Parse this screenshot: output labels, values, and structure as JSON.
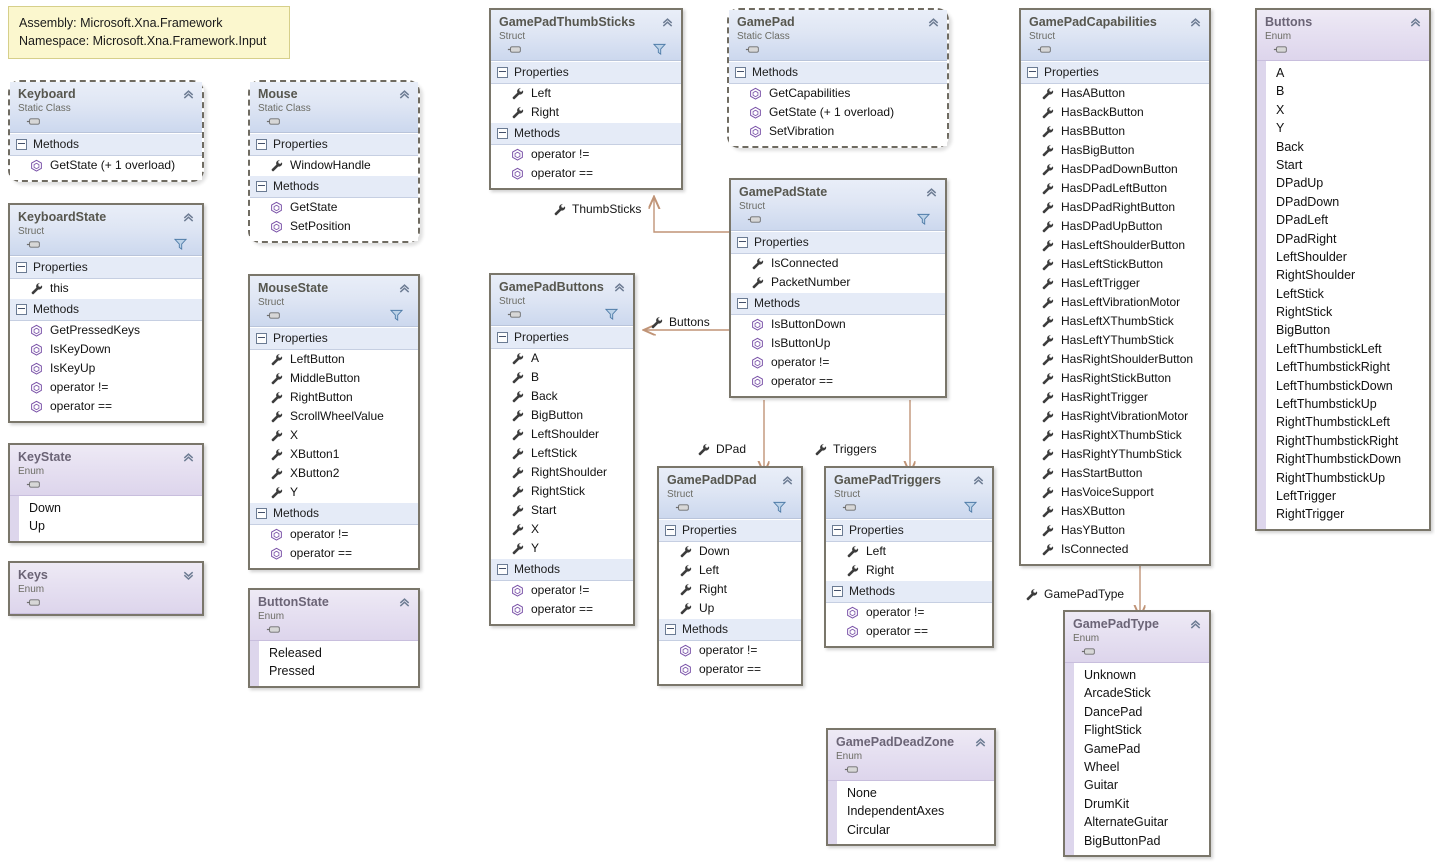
{
  "note": {
    "line1": "Assembly: Microsoft.Xna.Framework",
    "line2": "Namespace: Microsoft.Xna.Framework.Input"
  },
  "nodes": {
    "keyboard": {
      "title": "Keyboard",
      "kind": "Static Class",
      "groups": [
        {
          "label": "Methods",
          "members": [
            "GetState (+ 1 overload)"
          ]
        }
      ]
    },
    "keyboardState": {
      "title": "KeyboardState",
      "kind": "Struct",
      "groups": [
        {
          "label": "Properties",
          "members": [
            "this"
          ]
        },
        {
          "label": "Methods",
          "members": [
            "GetPressedKeys",
            "IsKeyDown",
            "IsKeyUp",
            "operator !=",
            "operator =="
          ]
        }
      ]
    },
    "keyState": {
      "title": "KeyState",
      "kind": "Enum",
      "values": [
        "Down",
        "Up"
      ]
    },
    "keys": {
      "title": "Keys",
      "kind": "Enum",
      "values": []
    },
    "mouse": {
      "title": "Mouse",
      "kind": "Static Class",
      "groups": [
        {
          "label": "Properties",
          "members": [
            "WindowHandle"
          ]
        },
        {
          "label": "Methods",
          "members": [
            "GetState",
            "SetPosition"
          ]
        }
      ]
    },
    "mouseState": {
      "title": "MouseState",
      "kind": "Struct",
      "groups": [
        {
          "label": "Properties",
          "members": [
            "LeftButton",
            "MiddleButton",
            "RightButton",
            "ScrollWheelValue",
            "X",
            "XButton1",
            "XButton2",
            "Y"
          ]
        },
        {
          "label": "Methods",
          "members": [
            "operator !=",
            "operator =="
          ]
        }
      ]
    },
    "buttonState": {
      "title": "ButtonState",
      "kind": "Enum",
      "values": [
        "Released",
        "Pressed"
      ]
    },
    "gamePadThumbSticks": {
      "title": "GamePadThumbSticks",
      "kind": "Struct",
      "groups": [
        {
          "label": "Properties",
          "members": [
            "Left",
            "Right"
          ]
        },
        {
          "label": "Methods",
          "members": [
            "operator !=",
            "operator =="
          ]
        }
      ]
    },
    "gamePad": {
      "title": "GamePad",
      "kind": "Static Class",
      "groups": [
        {
          "label": "Methods",
          "members": [
            "GetCapabilities",
            "GetState (+ 1 overload)",
            "SetVibration"
          ]
        }
      ]
    },
    "gamePadState": {
      "title": "GamePadState",
      "kind": "Struct",
      "groups": [
        {
          "label": "Properties",
          "members": [
            "IsConnected",
            "PacketNumber"
          ]
        },
        {
          "label": "Methods",
          "members": [
            "IsButtonDown",
            "IsButtonUp",
            "operator !=",
            "operator =="
          ]
        }
      ]
    },
    "gamePadButtons": {
      "title": "GamePadButtons",
      "kind": "Struct",
      "groups": [
        {
          "label": "Properties",
          "members": [
            "A",
            "B",
            "Back",
            "BigButton",
            "LeftShoulder",
            "LeftStick",
            "RightShoulder",
            "RightStick",
            "Start",
            "X",
            "Y"
          ]
        },
        {
          "label": "Methods",
          "members": [
            "operator !=",
            "operator =="
          ]
        }
      ]
    },
    "gamePadDPad": {
      "title": "GamePadDPad",
      "kind": "Struct",
      "groups": [
        {
          "label": "Properties",
          "members": [
            "Down",
            "Left",
            "Right",
            "Up"
          ]
        },
        {
          "label": "Methods",
          "members": [
            "operator !=",
            "operator =="
          ]
        }
      ]
    },
    "gamePadTriggers": {
      "title": "GamePadTriggers",
      "kind": "Struct",
      "groups": [
        {
          "label": "Properties",
          "members": [
            "Left",
            "Right"
          ]
        },
        {
          "label": "Methods",
          "members": [
            "operator !=",
            "operator =="
          ]
        }
      ]
    },
    "gamePadCapabilities": {
      "title": "GamePadCapabilities",
      "kind": "Struct",
      "groups": [
        {
          "label": "Properties",
          "members": [
            "HasAButton",
            "HasBackButton",
            "HasBButton",
            "HasBigButton",
            "HasDPadDownButton",
            "HasDPadLeftButton",
            "HasDPadRightButton",
            "HasDPadUpButton",
            "HasLeftShoulderButton",
            "HasLeftStickButton",
            "HasLeftTrigger",
            "HasLeftVibrationMotor",
            "HasLeftXThumbStick",
            "HasLeftYThumbStick",
            "HasRightShoulderButton",
            "HasRightStickButton",
            "HasRightTrigger",
            "HasRightVibrationMotor",
            "HasRightXThumbStick",
            "HasRightYThumbStick",
            "HasStartButton",
            "HasVoiceSupport",
            "HasXButton",
            "HasYButton",
            "IsConnected"
          ]
        }
      ]
    },
    "buttons": {
      "title": "Buttons",
      "kind": "Enum",
      "values": [
        "A",
        "B",
        "X",
        "Y",
        "Back",
        "Start",
        "DPadUp",
        "DPadDown",
        "DPadLeft",
        "DPadRight",
        "LeftShoulder",
        "RightShoulder",
        "LeftStick",
        "RightStick",
        "BigButton",
        "LeftThumbstickLeft",
        "LeftThumbstickRight",
        "LeftThumbstickDown",
        "LeftThumbstickUp",
        "RightThumbstickLeft",
        "RightThumbstickRight",
        "RightThumbstickDown",
        "RightThumbstickUp",
        "LeftTrigger",
        "RightTrigger"
      ]
    },
    "gamePadType": {
      "title": "GamePadType",
      "kind": "Enum",
      "values": [
        "Unknown",
        "ArcadeStick",
        "DancePad",
        "FlightStick",
        "GamePad",
        "Wheel",
        "Guitar",
        "DrumKit",
        "AlternateGuitar",
        "BigButtonPad"
      ]
    },
    "gamePadDeadZone": {
      "title": "GamePadDeadZone",
      "kind": "Enum",
      "values": [
        "None",
        "IndependentAxes",
        "Circular"
      ]
    }
  },
  "associations": {
    "thumbSticks": "ThumbSticks",
    "buttons": "Buttons",
    "dpad": "DPad",
    "triggers": "Triggers",
    "gamePadType": "GamePadType"
  },
  "colors": {
    "note_bg": "#fbf7ce",
    "class_header": "#dfe6f4",
    "enum_header": "#e6e0f1",
    "group_row": "#e5ebf7",
    "connector": "#c09477",
    "border": "#7a766a"
  }
}
